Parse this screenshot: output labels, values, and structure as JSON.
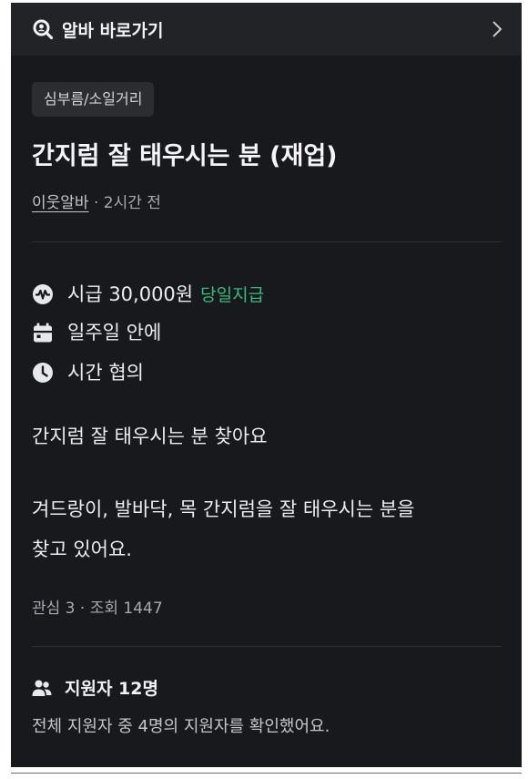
{
  "topbar": {
    "link_label": "알바 바로가기",
    "icon": "search-icon",
    "chevron": "chevron-right-icon"
  },
  "post": {
    "category": "심부름/소일거리",
    "title": "간지럼 잘 태우시는 분 (재업)",
    "author": "이웃알바",
    "posted": "· 2시간 전"
  },
  "details": {
    "wage": "시급 30,000원",
    "pay_badge": "당일지급",
    "pay_badge_color": "#3bba7e",
    "schedule": "일주일 안에",
    "hours": "시간 협의"
  },
  "content": {
    "line1": "간지럼 잘 태우시는 분 찾아요",
    "line2": "겨드랑이, 발바닥, 목 간지럼을 잘 태우시는 분을",
    "line3": "찾고 있어요."
  },
  "stats": {
    "text": "관심 3 · 조회 1447"
  },
  "applicants": {
    "title": "지원자 12명",
    "description": "전체 지원자 중 4명의 지원자를 확인했어요."
  }
}
